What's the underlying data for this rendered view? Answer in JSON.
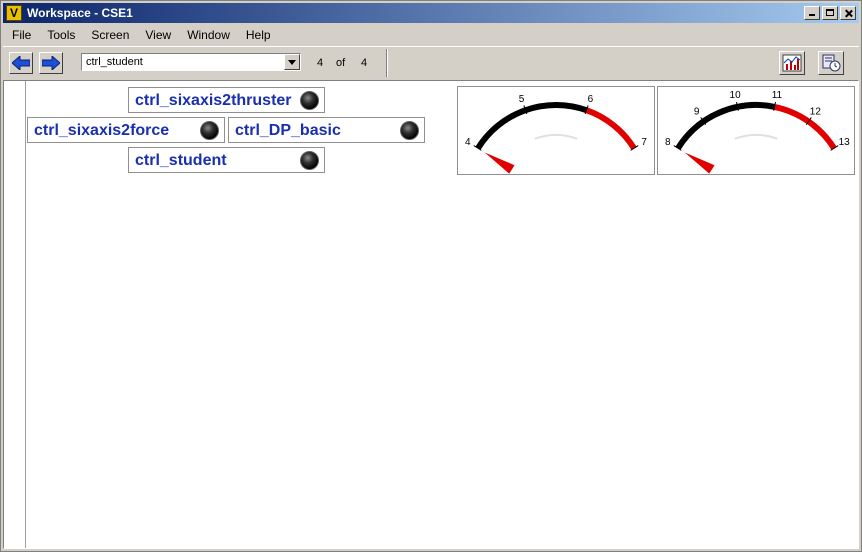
{
  "window": {
    "title": "Workspace - CSE1",
    "app_icon_letter": "V"
  },
  "menu": {
    "items": [
      "File",
      "Tools",
      "Screen",
      "View",
      "Window",
      "Help"
    ]
  },
  "toolbar": {
    "back_icon": "back-arrow-icon",
    "forward_icon": "forward-arrow-icon",
    "screen_select_value": "ctrl_student",
    "page_current": "4",
    "page_of": "of",
    "page_total": "4",
    "chart_tool_icon": "chart-icon",
    "settings_tool_icon": "settings-clock-icon"
  },
  "controls": [
    {
      "label": "ctrl_sixaxis2thruster",
      "state": "off"
    },
    {
      "label": "ctrl_sixaxis2force",
      "state": "off"
    },
    {
      "label": "ctrl_DP_basic",
      "state": "off"
    },
    {
      "label": "ctrl_student",
      "state": "off"
    }
  ],
  "gauges": [
    {
      "ticks": [
        "4",
        "5",
        "6",
        "7"
      ],
      "min": 4,
      "max": 7,
      "redzone_start": 6,
      "value": 4
    },
    {
      "ticks": [
        "8",
        "9",
        "10",
        "11",
        "12",
        "13"
      ],
      "min": 8,
      "max": 13,
      "redzone_start": 11,
      "value": 8
    }
  ],
  "colors": {
    "control_label": "#1a2fb0",
    "gauge_red": "#e00000",
    "titlebar_start": "#0a246a",
    "titlebar_end": "#a6caf0"
  }
}
